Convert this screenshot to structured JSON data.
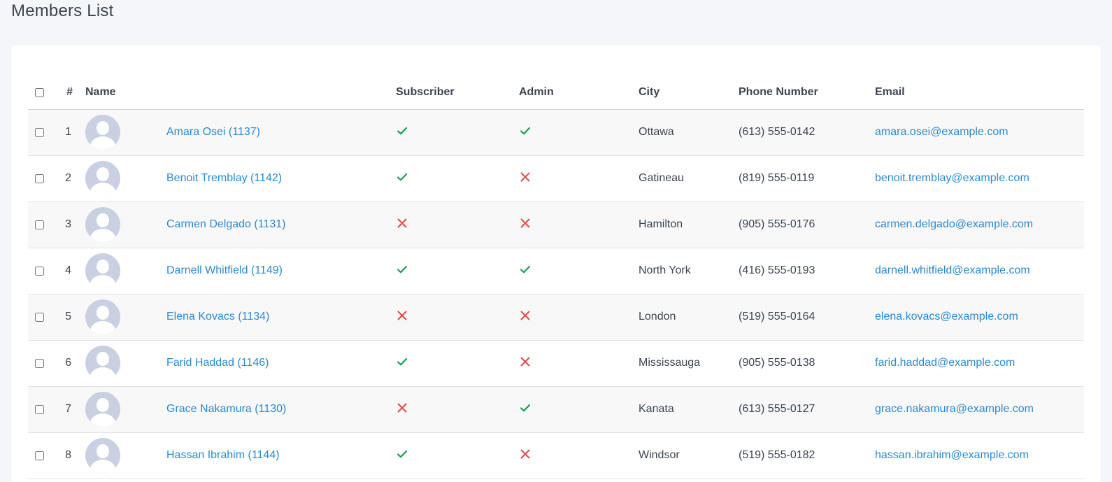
{
  "page": {
    "title": "Members List"
  },
  "colors": {
    "link": "#2b89d3",
    "check": "#1e9c5a",
    "cross": "#e34848"
  },
  "table": {
    "headers": {
      "number": "#",
      "name": "Name",
      "subscriber": "Subscriber",
      "admin": "Admin",
      "city": "City",
      "phone": "Phone Number",
      "email": "Email"
    },
    "rows": [
      {
        "number": "1",
        "name": "Amara Osei (1137)",
        "subscriber": true,
        "admin": true,
        "city": "Ottawa",
        "phone": "(613) 555-0142",
        "email": "amara.osei@example.com"
      },
      {
        "number": "2",
        "name": "Benoit Tremblay (1142)",
        "subscriber": true,
        "admin": false,
        "city": "Gatineau",
        "phone": "(819) 555-0119",
        "email": "benoit.tremblay@example.com"
      },
      {
        "number": "3",
        "name": "Carmen Delgado (1131)",
        "subscriber": false,
        "admin": false,
        "city": "Hamilton",
        "phone": "(905) 555-0176",
        "email": "carmen.delgado@example.com"
      },
      {
        "number": "4",
        "name": "Darnell Whitfield (1149)",
        "subscriber": true,
        "admin": true,
        "city": "North York",
        "phone": "(416) 555-0193",
        "email": "darnell.whitfield@example.com"
      },
      {
        "number": "5",
        "name": "Elena Kovacs (1134)",
        "subscriber": false,
        "admin": false,
        "city": "London",
        "phone": "(519) 555-0164",
        "email": "elena.kovacs@example.com"
      },
      {
        "number": "6",
        "name": "Farid Haddad (1146)",
        "subscriber": true,
        "admin": false,
        "city": "Mississauga",
        "phone": "(905) 555-0138",
        "email": "farid.haddad@example.com"
      },
      {
        "number": "7",
        "name": "Grace Nakamura (1130)",
        "subscriber": false,
        "admin": true,
        "city": "Kanata",
        "phone": "(613) 555-0127",
        "email": "grace.nakamura@example.com"
      },
      {
        "number": "8",
        "name": "Hassan Ibrahim (1144)",
        "subscriber": true,
        "admin": false,
        "city": "Windsor",
        "phone": "(519) 555-0182",
        "email": "hassan.ibrahim@example.com"
      }
    ]
  }
}
